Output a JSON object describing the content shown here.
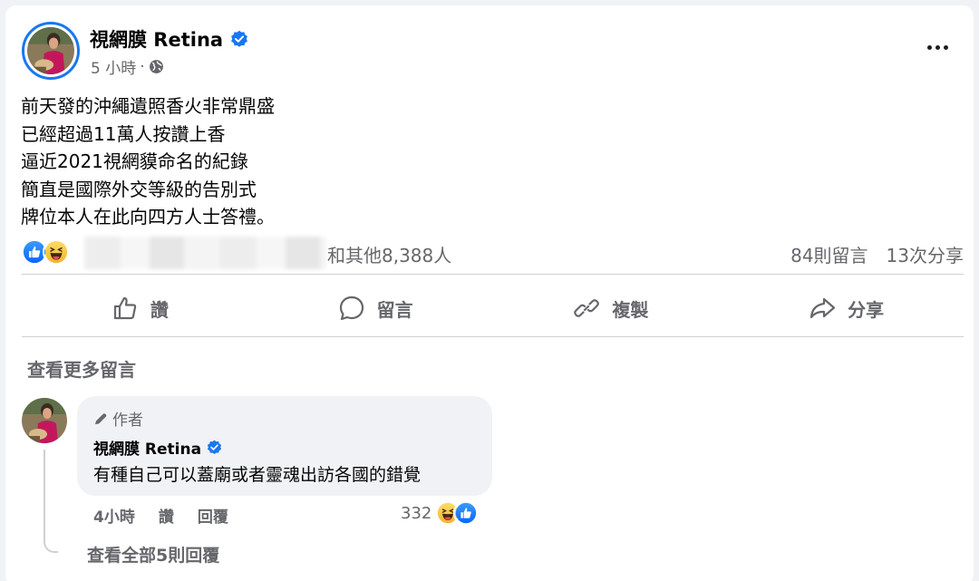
{
  "post": {
    "page_name": "視網膜 Retina",
    "time": "5 小時",
    "dot": "·",
    "lines": [
      "前天發的沖繩遺照香火非常鼎盛",
      "已經超過11萬人按讚上香",
      "逼近2021視網貘命名的紀錄",
      "簡直是國際外交等級的告別式",
      "牌位本人在此向四方人士答禮。"
    ]
  },
  "reactions": {
    "others_text": "和其他8,388人",
    "comments_count": "84則留言",
    "shares_count": "13次分享"
  },
  "actions": {
    "like": "讚",
    "comment": "留言",
    "copy": "複製",
    "share": "分享"
  },
  "comments": {
    "see_more": "查看更多留言",
    "item": {
      "author_badge": "作者",
      "name": "視網膜 Retina",
      "text": "有種自己可以蓋廟或者靈魂出訪各國的錯覺",
      "time": "4小時",
      "like": "讚",
      "reply": "回覆",
      "reaction_count": "332"
    },
    "view_replies": "查看全部5則回覆"
  },
  "colors": {
    "accent": "#1877f2",
    "secondary_text": "#65676b"
  }
}
